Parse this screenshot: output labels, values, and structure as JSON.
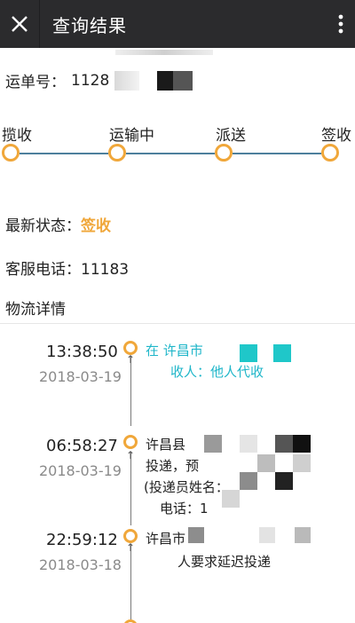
{
  "header": {
    "title": "查询结果",
    "close_icon": "close-icon",
    "more_icon": "more-vertical-icon"
  },
  "waybill": {
    "label": "运单号：",
    "number_visible": "1128"
  },
  "progress": {
    "steps": [
      "揽收",
      "运输中",
      "派送",
      "签收"
    ],
    "accent": "#f0a73a",
    "line_color": "#4d7f9c"
  },
  "status": {
    "label": "最新状态：",
    "value": "签收"
  },
  "service_phone": {
    "text": "客服电话：11183"
  },
  "details_title": "物流详情",
  "timeline": [
    {
      "time": "13:38:50",
      "date": "2018-03-19",
      "line1": "在 许昌市",
      "line2": "收人：他人代收"
    },
    {
      "time": "06:58:27",
      "date": "2018-03-19",
      "line1": "许昌县",
      "line2": "投递，预",
      "line3": "(投递员姓名：",
      "line4": "电话：1"
    },
    {
      "time": "22:59:12",
      "date": "2018-03-18",
      "line1": "许昌市",
      "line2": "人要求延迟投递"
    }
  ]
}
